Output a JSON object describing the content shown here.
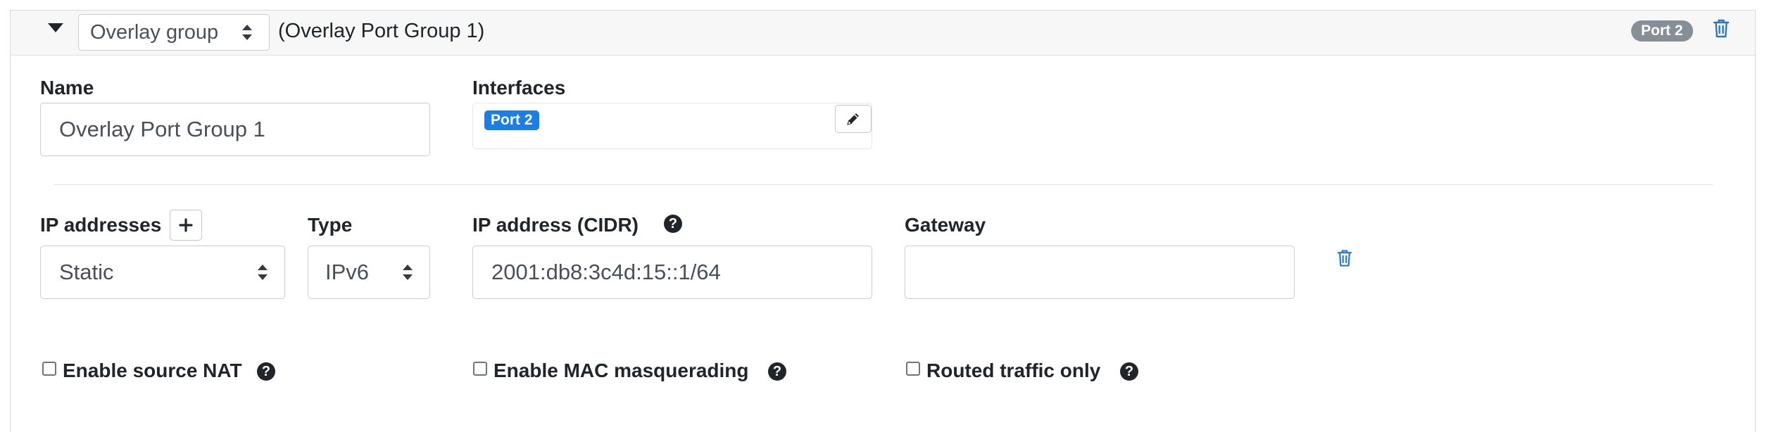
{
  "header": {
    "group_type_select": "Overlay group",
    "group_title": "(Overlay Port Group 1)",
    "port_badge": "Port 2"
  },
  "name": {
    "label": "Name",
    "value": "Overlay Port Group 1"
  },
  "interfaces": {
    "label": "Interfaces",
    "items": [
      "Port 2"
    ]
  },
  "ip": {
    "addresses_label": "IP addresses",
    "type_label": "Type",
    "cidr_label": "IP address (CIDR)",
    "gateway_label": "Gateway",
    "mode_select": "Static",
    "type_select": "IPv6",
    "cidr_value": "2001:db8:3c4d:15::1/64",
    "gateway_value": ""
  },
  "options": {
    "source_nat_label": "Enable source NAT",
    "mac_masq_label": "Enable MAC masquerading",
    "routed_only_label": "Routed traffic only",
    "source_nat_checked": false,
    "mac_masq_checked": false,
    "routed_only_checked": false
  },
  "help_glyph": "?",
  "colors": {
    "header_bg": "#f7f7f7",
    "port_badge_bg": "#868e96",
    "interface_badge_bg": "#1a7ee6",
    "trash_icon": "#2b78c2"
  }
}
